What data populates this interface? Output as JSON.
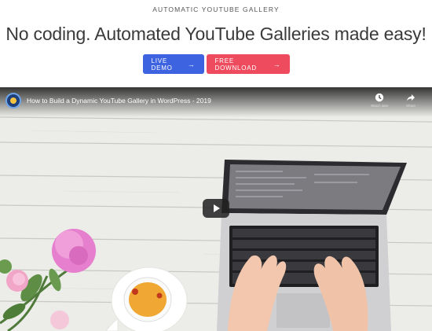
{
  "hero": {
    "eyebrow": "AUTOMATIC YOUTUBE GALLERY",
    "headline": "No coding. Automated YouTube Galleries made easy!",
    "buttons": {
      "demo_label": "LIVE DEMO",
      "download_label": "FREE DOWNLOAD",
      "arrow": "→"
    }
  },
  "video": {
    "title": "How to Build a Dynamic YouTube Gallery in WordPress - 2019",
    "actions": {
      "watch_later_icon": "clock-icon",
      "watch_later_label": "Watch later",
      "share_icon": "share-icon",
      "share_label": "Share"
    },
    "play_icon": "play-icon"
  },
  "colors": {
    "demo_button": "#3d63e0",
    "download_button": "#ef4b5e",
    "headline_text": "#3a3a3a"
  }
}
